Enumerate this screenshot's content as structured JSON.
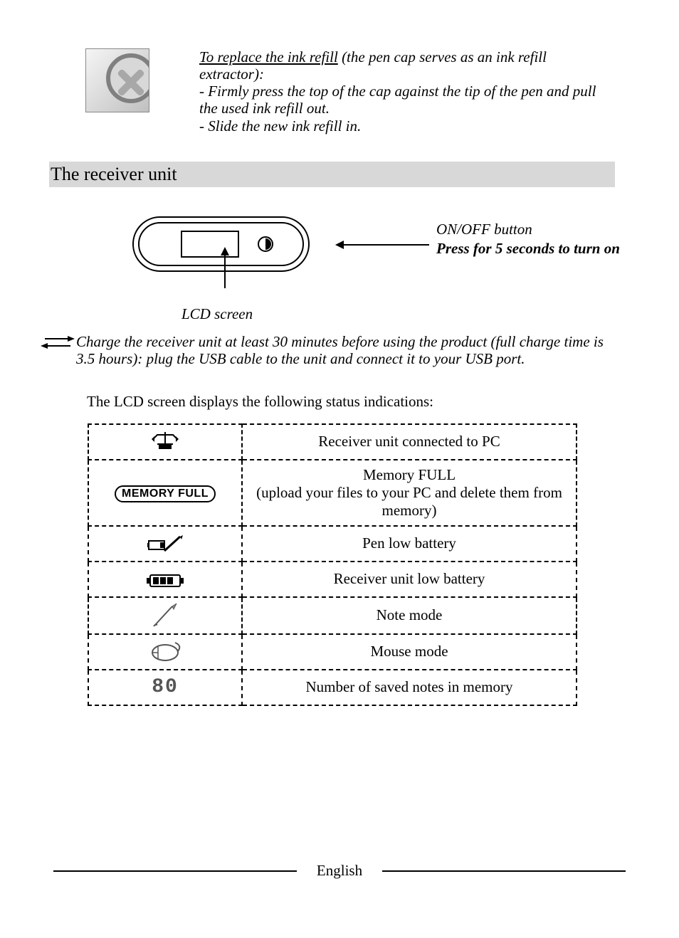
{
  "refill": {
    "heading": "To replace the ink refill",
    "heading_tail": " (the pen cap serves as an ink refill extractor):",
    "step1": "- Firmly press the top of the cap against the tip of the pen and pull the used ink refill out.",
    "step2": "- Slide the new ink refill in."
  },
  "section_title": "The receiver unit",
  "diagram": {
    "onoff_line1": "ON/OFF button",
    "onoff_line2": "Press for 5 seconds to turn on",
    "lcd_label": "LCD screen"
  },
  "charge_note": "Charge the receiver unit at least 30 minutes before using the product (full charge time is 3.5 hours): plug the USB cable to the unit and connect it to your USB port.",
  "status_intro": "The LCD screen displays the following status indications:",
  "status_rows": [
    {
      "icon": "connected-icon",
      "desc": "Receiver unit connected to PC"
    },
    {
      "icon": "memory-full-icon",
      "label": "MEMORY FULL",
      "desc": "Memory FULL\n(upload your files to your PC and delete them from memory)"
    },
    {
      "icon": "pen-low-battery-icon",
      "desc": "Pen low battery"
    },
    {
      "icon": "receiver-low-battery-icon",
      "desc": "Receiver unit low battery"
    },
    {
      "icon": "note-mode-icon",
      "desc": "Note mode"
    },
    {
      "icon": "mouse-mode-icon",
      "desc": "Mouse mode"
    },
    {
      "icon": "saved-notes-count-icon",
      "value": "80",
      "desc": "Number of saved notes in memory"
    }
  ],
  "footer_lang": "English"
}
